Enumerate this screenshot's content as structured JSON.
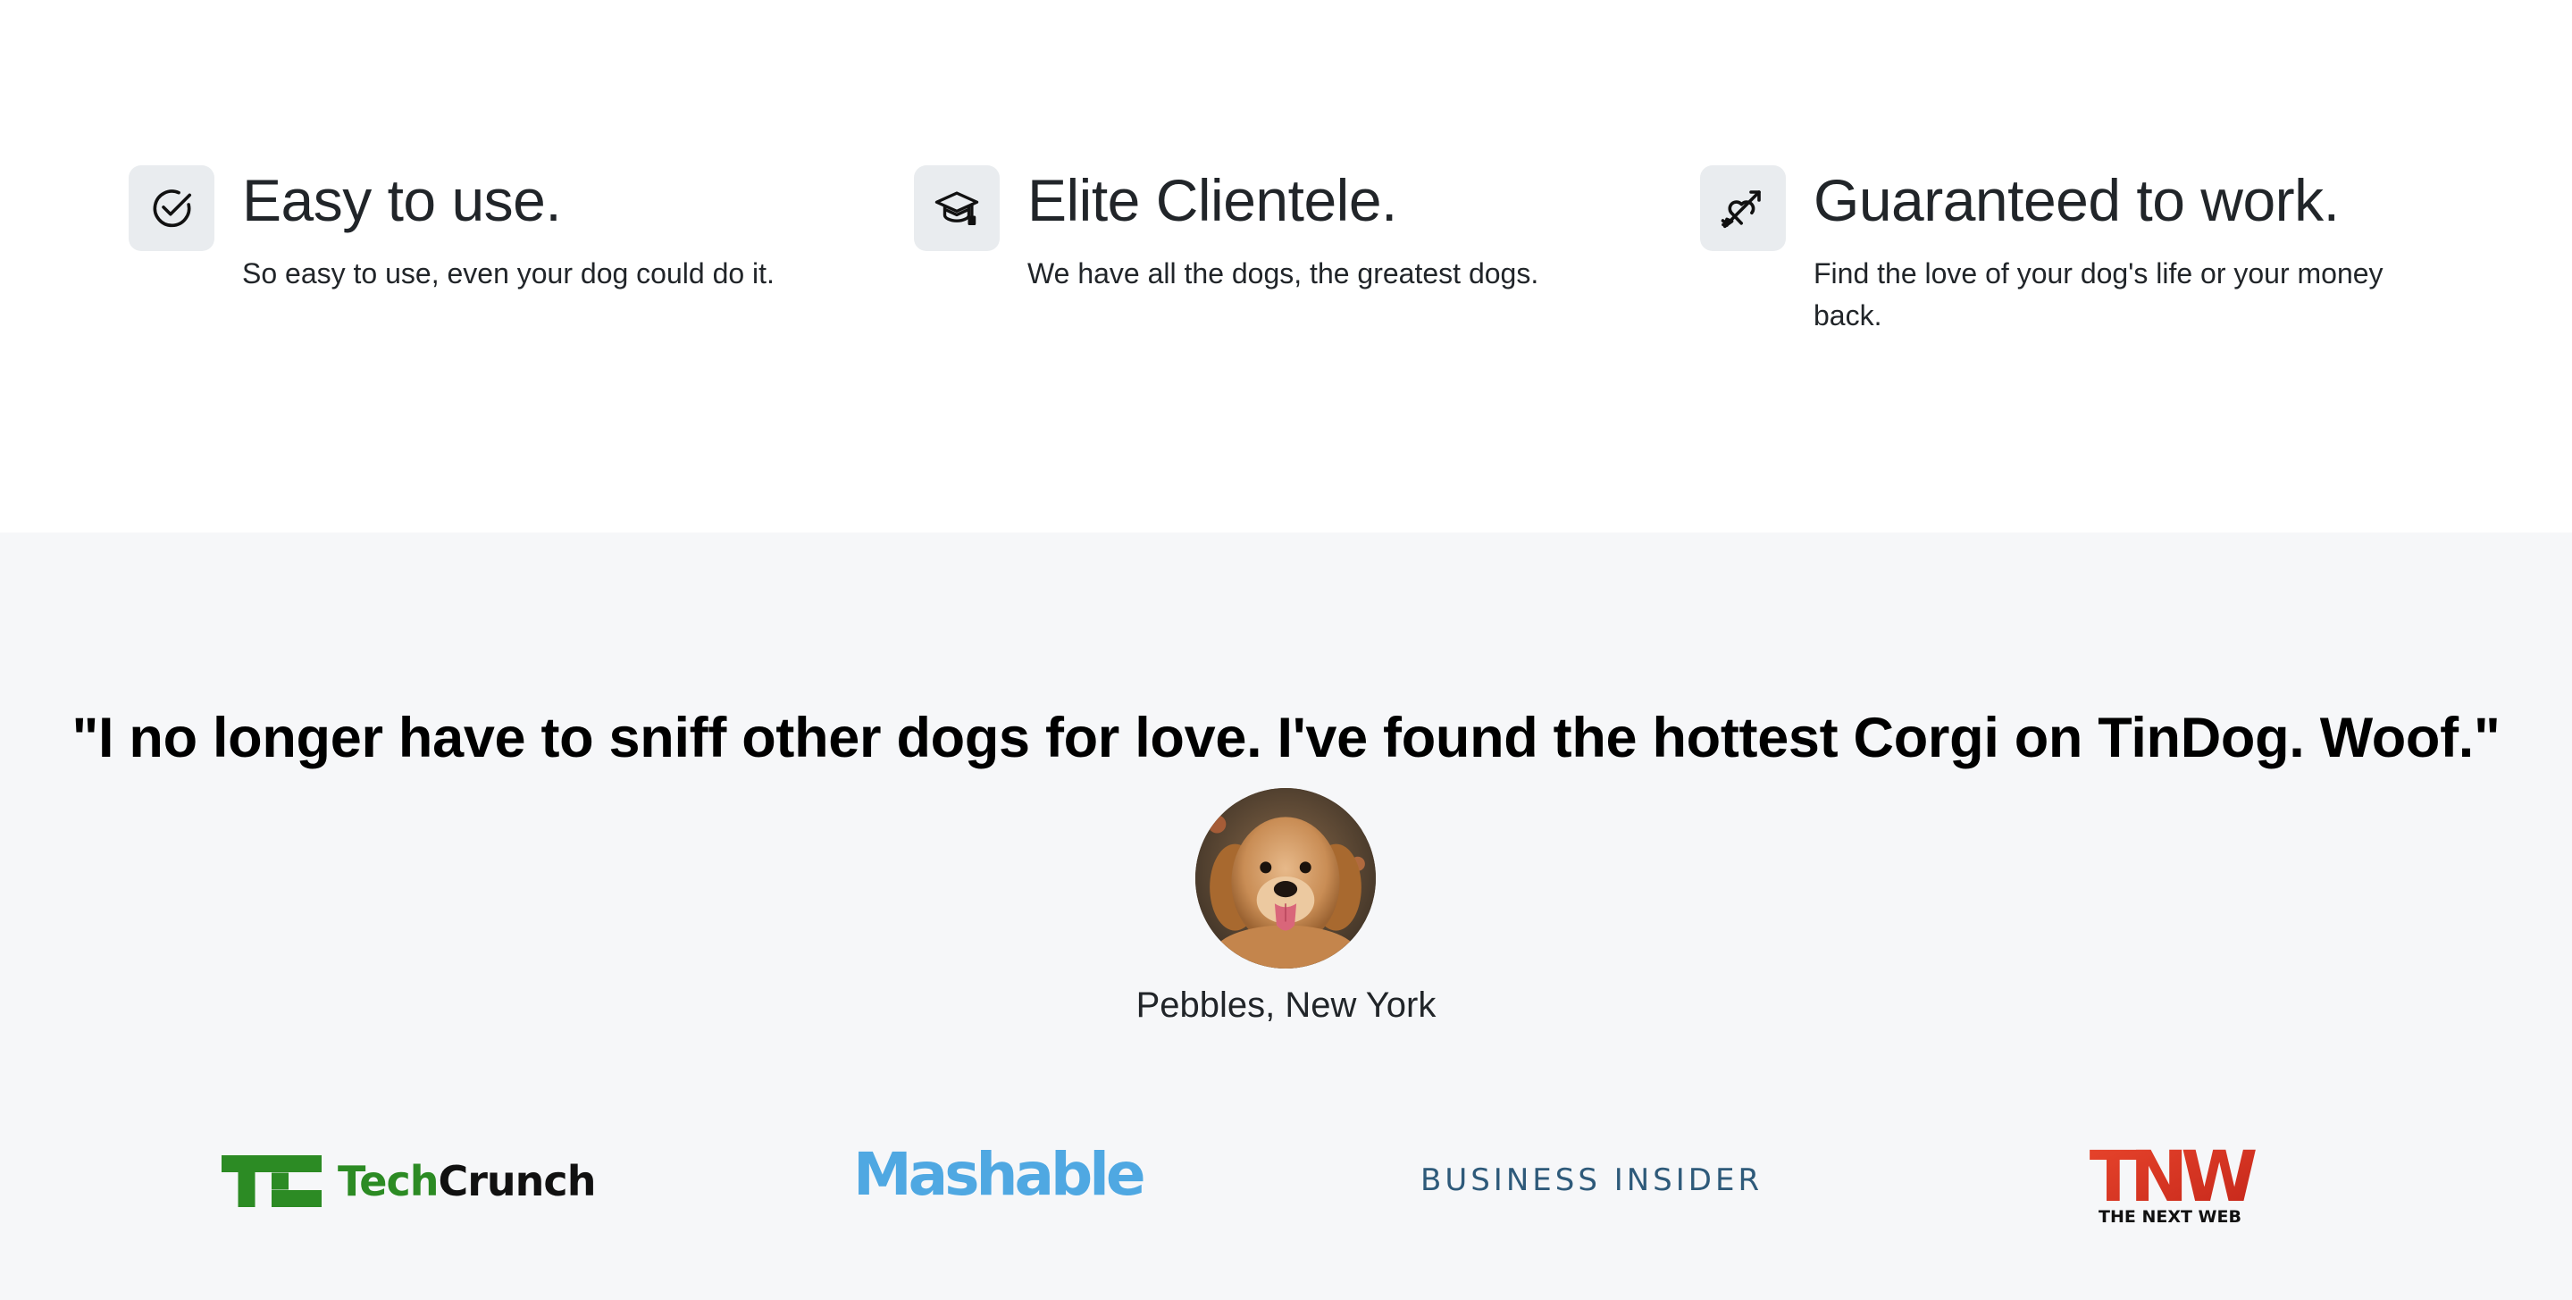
{
  "features": [
    {
      "icon": "circle-check-icon",
      "title": "Easy to use.",
      "description": "So easy to use, even your dog could do it."
    },
    {
      "icon": "graduation-cap-icon",
      "title": "Elite Clientele.",
      "description": "We have all the dogs, the greatest dogs."
    },
    {
      "icon": "heart-arrow-icon",
      "title": "Guaranteed to work.",
      "description": "Find the love of your dog's life or your money back."
    }
  ],
  "testimonial": {
    "quote": "\"I no longer have to sniff other dogs for love. I've found the hottest Corgi on TinDog. Woof.\"",
    "avatar": "dog-avatar",
    "attribution": "Pebbles, New York"
  },
  "press": {
    "techcrunch": {
      "prefix": "Tech",
      "suffix": "Crunch"
    },
    "mashable": "Mashable",
    "business_insider": "BUSINESS INSIDER",
    "tnw": {
      "mark": "TNW",
      "subtitle": "THE NEXT WEB"
    }
  },
  "colors": {
    "features_bg": "#ffffff",
    "testimonials_bg": "#f6f7f9",
    "icon_bg": "#e9ecef",
    "techcrunch_green": "#2c8b24",
    "mashable_blue": "#4fa8e2",
    "business_insider_blue": "#2e5a7a",
    "tnw_red": "#e8452c"
  }
}
